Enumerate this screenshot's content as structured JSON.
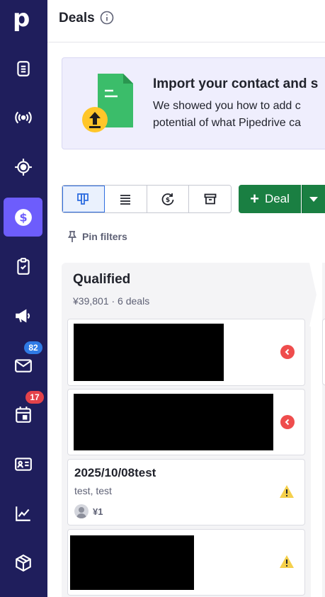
{
  "app": {
    "logo_letter": "p"
  },
  "sidebar": {
    "items": [
      {
        "name": "leads",
        "icon": "document-list-icon"
      },
      {
        "name": "campaigns",
        "icon": "broadcast-icon"
      },
      {
        "name": "projects",
        "icon": "target-icon"
      },
      {
        "name": "deals",
        "icon": "dollar-icon",
        "active": true
      },
      {
        "name": "activities",
        "icon": "clipboard-check-icon"
      },
      {
        "name": "marketing",
        "icon": "megaphone-icon"
      },
      {
        "name": "mail",
        "icon": "mail-icon",
        "badge": "82"
      },
      {
        "name": "calendar",
        "icon": "calendar-icon",
        "badge": "17"
      },
      {
        "name": "contacts",
        "icon": "contact-card-icon"
      },
      {
        "name": "insights",
        "icon": "chart-line-icon"
      },
      {
        "name": "products",
        "icon": "box-icon"
      }
    ]
  },
  "header": {
    "title": "Deals"
  },
  "banner": {
    "title": "Import your contact and s",
    "line1": "We showed you how to add c",
    "line2": "potential of what Pipedrive ca"
  },
  "toolbar": {
    "views": [
      "pipeline-view",
      "list-view",
      "forecast-view",
      "archive-view"
    ],
    "active_view": "pipeline-view",
    "add_deal_label": "Deal",
    "add_deal_plus": "+",
    "pin_filters_label": "Pin filters"
  },
  "stage": {
    "title": "Qualified",
    "summary": "¥39,801 · 6 deals"
  },
  "cards": [
    {
      "redacted": true,
      "status": "overdue"
    },
    {
      "redacted": true,
      "status": "overdue"
    },
    {
      "redacted": false,
      "title": "2025/10/08test",
      "subtitle": "test, test",
      "value": "¥1",
      "status": "warning"
    },
    {
      "redacted": true,
      "status": "warning"
    }
  ],
  "colors": {
    "sidebar": "#1f1e5c",
    "active_nav": "#6d5dfc",
    "primary_green": "#1a7f42",
    "overdue_red": "#ef4d4d",
    "warning_yellow": "#f5d04c"
  }
}
